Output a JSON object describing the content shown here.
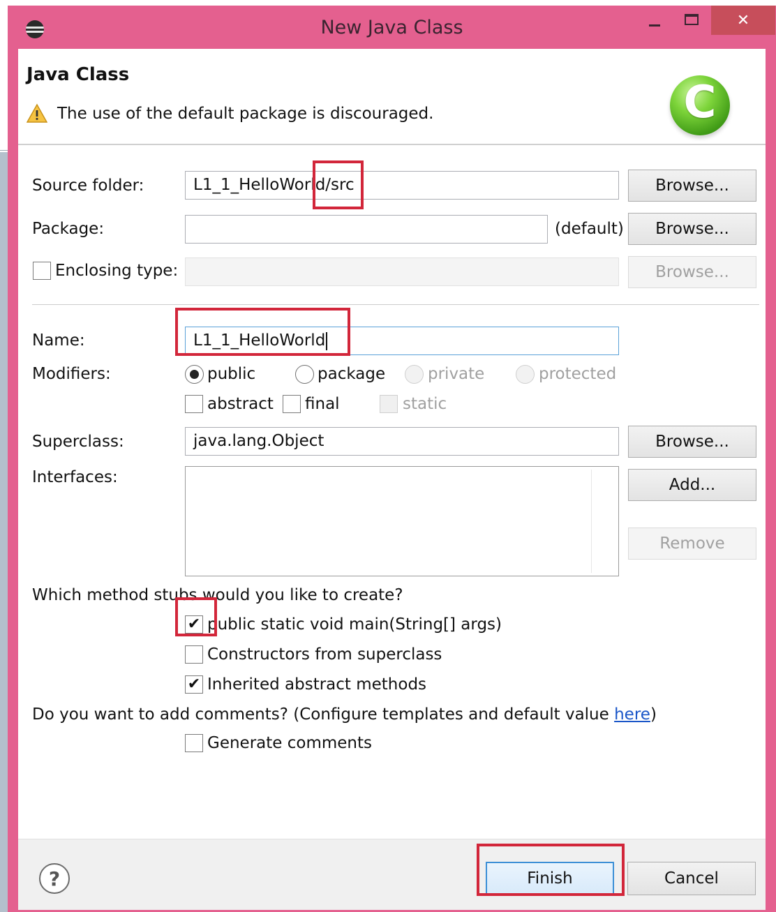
{
  "window": {
    "title": "New Java Class",
    "close_label": "✕"
  },
  "header": {
    "title": "Java Class",
    "message": "The use of the default package is discouraged.",
    "logo_letter": "C"
  },
  "fields": {
    "source_folder": {
      "label": "Source folder:",
      "value": "L1_1_HelloWorld/src",
      "button": "Browse..."
    },
    "package": {
      "label": "Package:",
      "value": "",
      "suffix": "(default)",
      "button": "Browse..."
    },
    "enclosing_type": {
      "label": "Enclosing type:",
      "value": "",
      "button": "Browse...",
      "checked": false
    },
    "name": {
      "label": "Name:",
      "value": "L1_1_HelloWorld"
    },
    "superclass": {
      "label": "Superclass:",
      "value": "java.lang.Object",
      "button": "Browse..."
    },
    "interfaces": {
      "label": "Interfaces:",
      "add_button": "Add...",
      "remove_button": "Remove"
    }
  },
  "modifiers": {
    "label": "Modifiers:",
    "access": [
      {
        "label": "public",
        "checked": true,
        "enabled": true
      },
      {
        "label": "package",
        "checked": false,
        "enabled": true
      },
      {
        "label": "private",
        "checked": false,
        "enabled": false
      },
      {
        "label": "protected",
        "checked": false,
        "enabled": false
      }
    ],
    "flags": [
      {
        "label": "abstract",
        "checked": false,
        "enabled": true
      },
      {
        "label": "final",
        "checked": false,
        "enabled": true
      },
      {
        "label": "static",
        "checked": false,
        "enabled": false
      }
    ]
  },
  "stubs": {
    "question": "Which method stubs would you like to create?",
    "options": [
      {
        "label": "public static void main(String[] args)",
        "checked": true
      },
      {
        "label": "Constructors from superclass",
        "checked": false
      },
      {
        "label": "Inherited abstract methods",
        "checked": true
      }
    ]
  },
  "comments": {
    "question_prefix": "Do you want to add comments? (Configure templates and default value ",
    "link": "here",
    "question_suffix": ")",
    "option": {
      "label": "Generate comments",
      "checked": false
    }
  },
  "footer": {
    "help": "?",
    "finish": "Finish",
    "cancel": "Cancel"
  },
  "colors": {
    "frame": "#e4608f",
    "highlight": "#d2263a",
    "accent": "#3c8fd6"
  }
}
